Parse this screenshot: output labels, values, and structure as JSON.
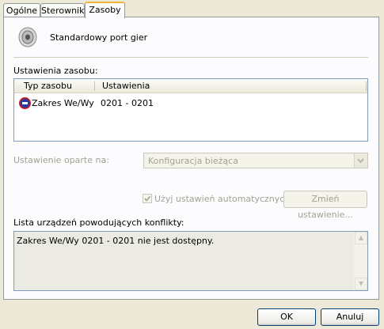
{
  "tabs": [
    "Ogólne",
    "Sterownik",
    "Zasoby"
  ],
  "device": {
    "name": "Standardowy port gier",
    "icon": "speaker-icon"
  },
  "resource_settings": {
    "label": "Ustawienia zasobu:",
    "columns": [
      "Typ zasobu",
      "Ustawienia"
    ],
    "rows": [
      {
        "type": "Zakres We/Wy",
        "setting": "0201 - 0201",
        "icon": "io-range-conflict-icon"
      }
    ]
  },
  "based_on": {
    "label": "Ustawienie oparte na:",
    "value": "Konfiguracja bieżąca"
  },
  "auto_settings": {
    "label": "Użyj ustawień automatycznych",
    "checked": true
  },
  "change_button": "Zmień ustawienie...",
  "conflicts": {
    "label": "Lista urządzeń powodujących konflikty:",
    "text": "Zakres We/Wy 0201 - 0201 nie jest dostępny."
  },
  "buttons": {
    "ok": "OK",
    "cancel": "Anuluj"
  },
  "colors": {
    "accent_tab": "#f0b43c",
    "border": "#919b9c",
    "input_border": "#7f9db9"
  }
}
